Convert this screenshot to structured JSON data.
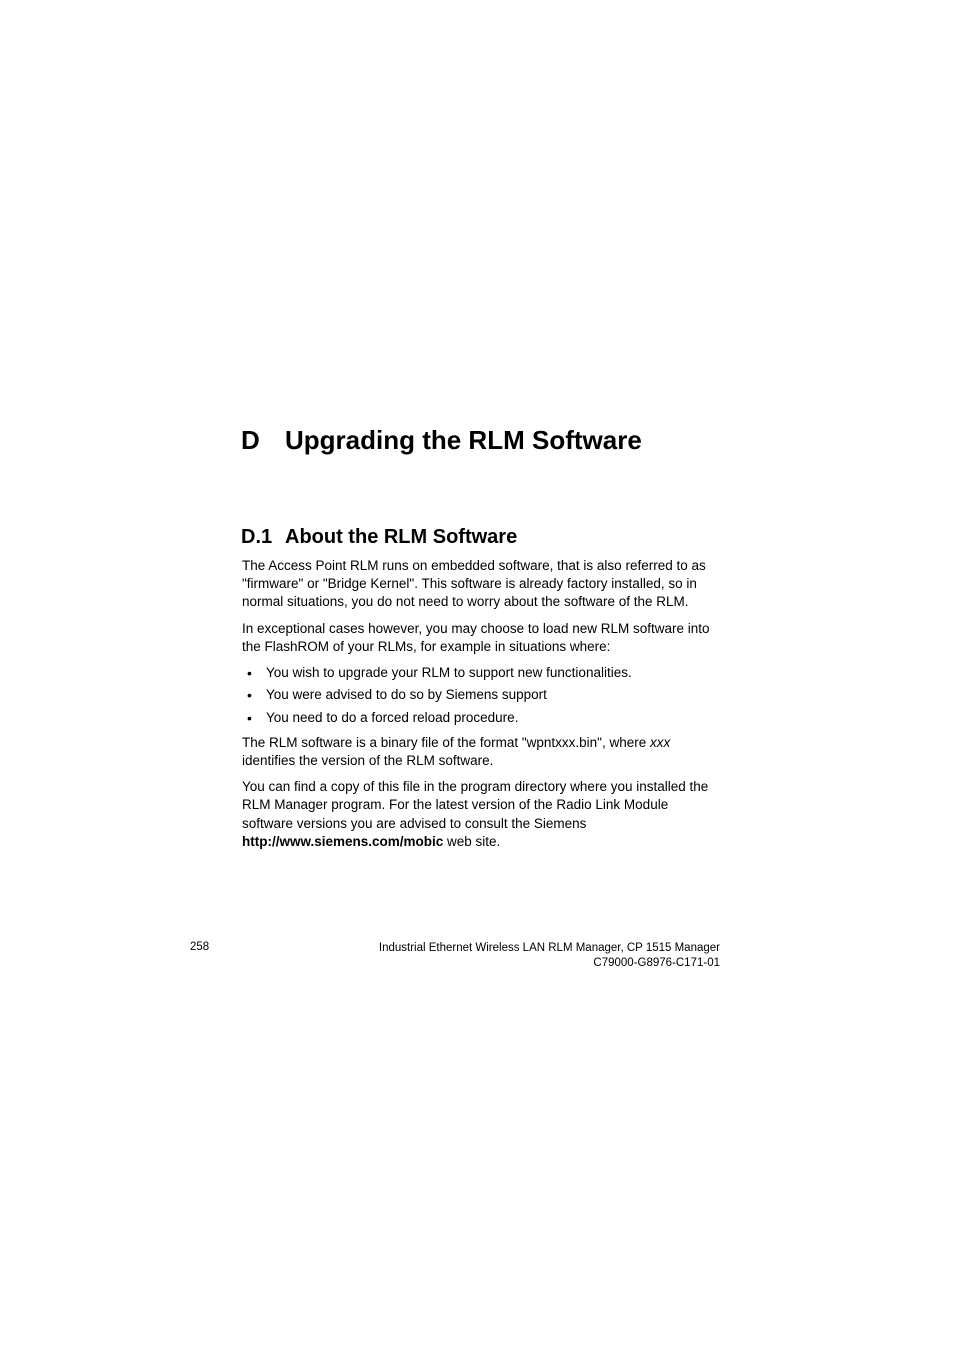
{
  "chapter": {
    "letter": "D",
    "title": "Upgrading the RLM Software"
  },
  "section": {
    "number": "D.1",
    "title": "About the RLM Software"
  },
  "paragraphs": {
    "p1": "The Access Point RLM runs on embedded software, that is also referred to as \"firmware\" or \"Bridge Kernel\". This software is already factory installed, so in normal situations, you do not need to worry about the software of the RLM.",
    "p2": "In exceptional cases however, you may choose to load new RLM software into the FlashROM of your RLMs, for example in situations where:",
    "p3_prefix": "The RLM software is a binary file of the format \"wpntxxx.bin\", where ",
    "p3_italic": "xxx",
    "p3_suffix": " identifies the version of the RLM software.",
    "p4_prefix": "You can find a copy of this file in the program directory where you installed the RLM Manager program. For the latest version of the Radio Link Module software versions you are advised to consult the Siemens ",
    "p4_bold": "http://www.siemens.com/mobic",
    "p4_suffix": " web site."
  },
  "bullets": {
    "b1": "You wish to upgrade your RLM to support new functionalities.",
    "b2": "You were advised to do so by Siemens support",
    "b3": "You need to do a forced reload procedure."
  },
  "footer": {
    "page_number": "258",
    "line1": "Industrial Ethernet Wireless LAN  RLM Manager,  CP 1515 Manager",
    "line2": "C79000-G8976-C171-01"
  }
}
